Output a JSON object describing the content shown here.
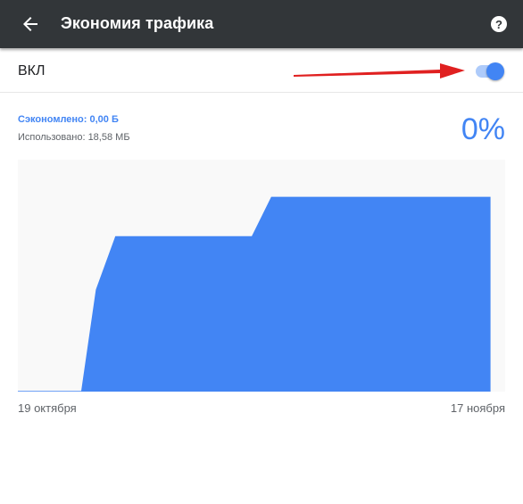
{
  "appbar": {
    "title": "Экономия трафика",
    "back_icon": "arrow-back-icon",
    "help_icon": "help-icon",
    "background": "#323639"
  },
  "toggle": {
    "label": "ВКЛ",
    "state": "on",
    "accent": "#4285f4",
    "annotation_arrow_color": "#e02020"
  },
  "stats": {
    "saved": "Сэкономлено: 0,00 Б",
    "used": "Использовано: 18,58 МБ",
    "percent": "0%"
  },
  "chart_data": {
    "type": "area",
    "xlabel": "",
    "ylabel": "",
    "x_start_label": "19 октября",
    "x_end_label": "17 ноября",
    "color": "#4285f4",
    "grid": false,
    "x": [
      0,
      13,
      16,
      20,
      45,
      48,
      52,
      97
    ],
    "values": [
      0.3,
      0.3,
      44,
      67,
      67,
      67,
      84,
      84
    ],
    "ylim": [
      0,
      100
    ]
  }
}
